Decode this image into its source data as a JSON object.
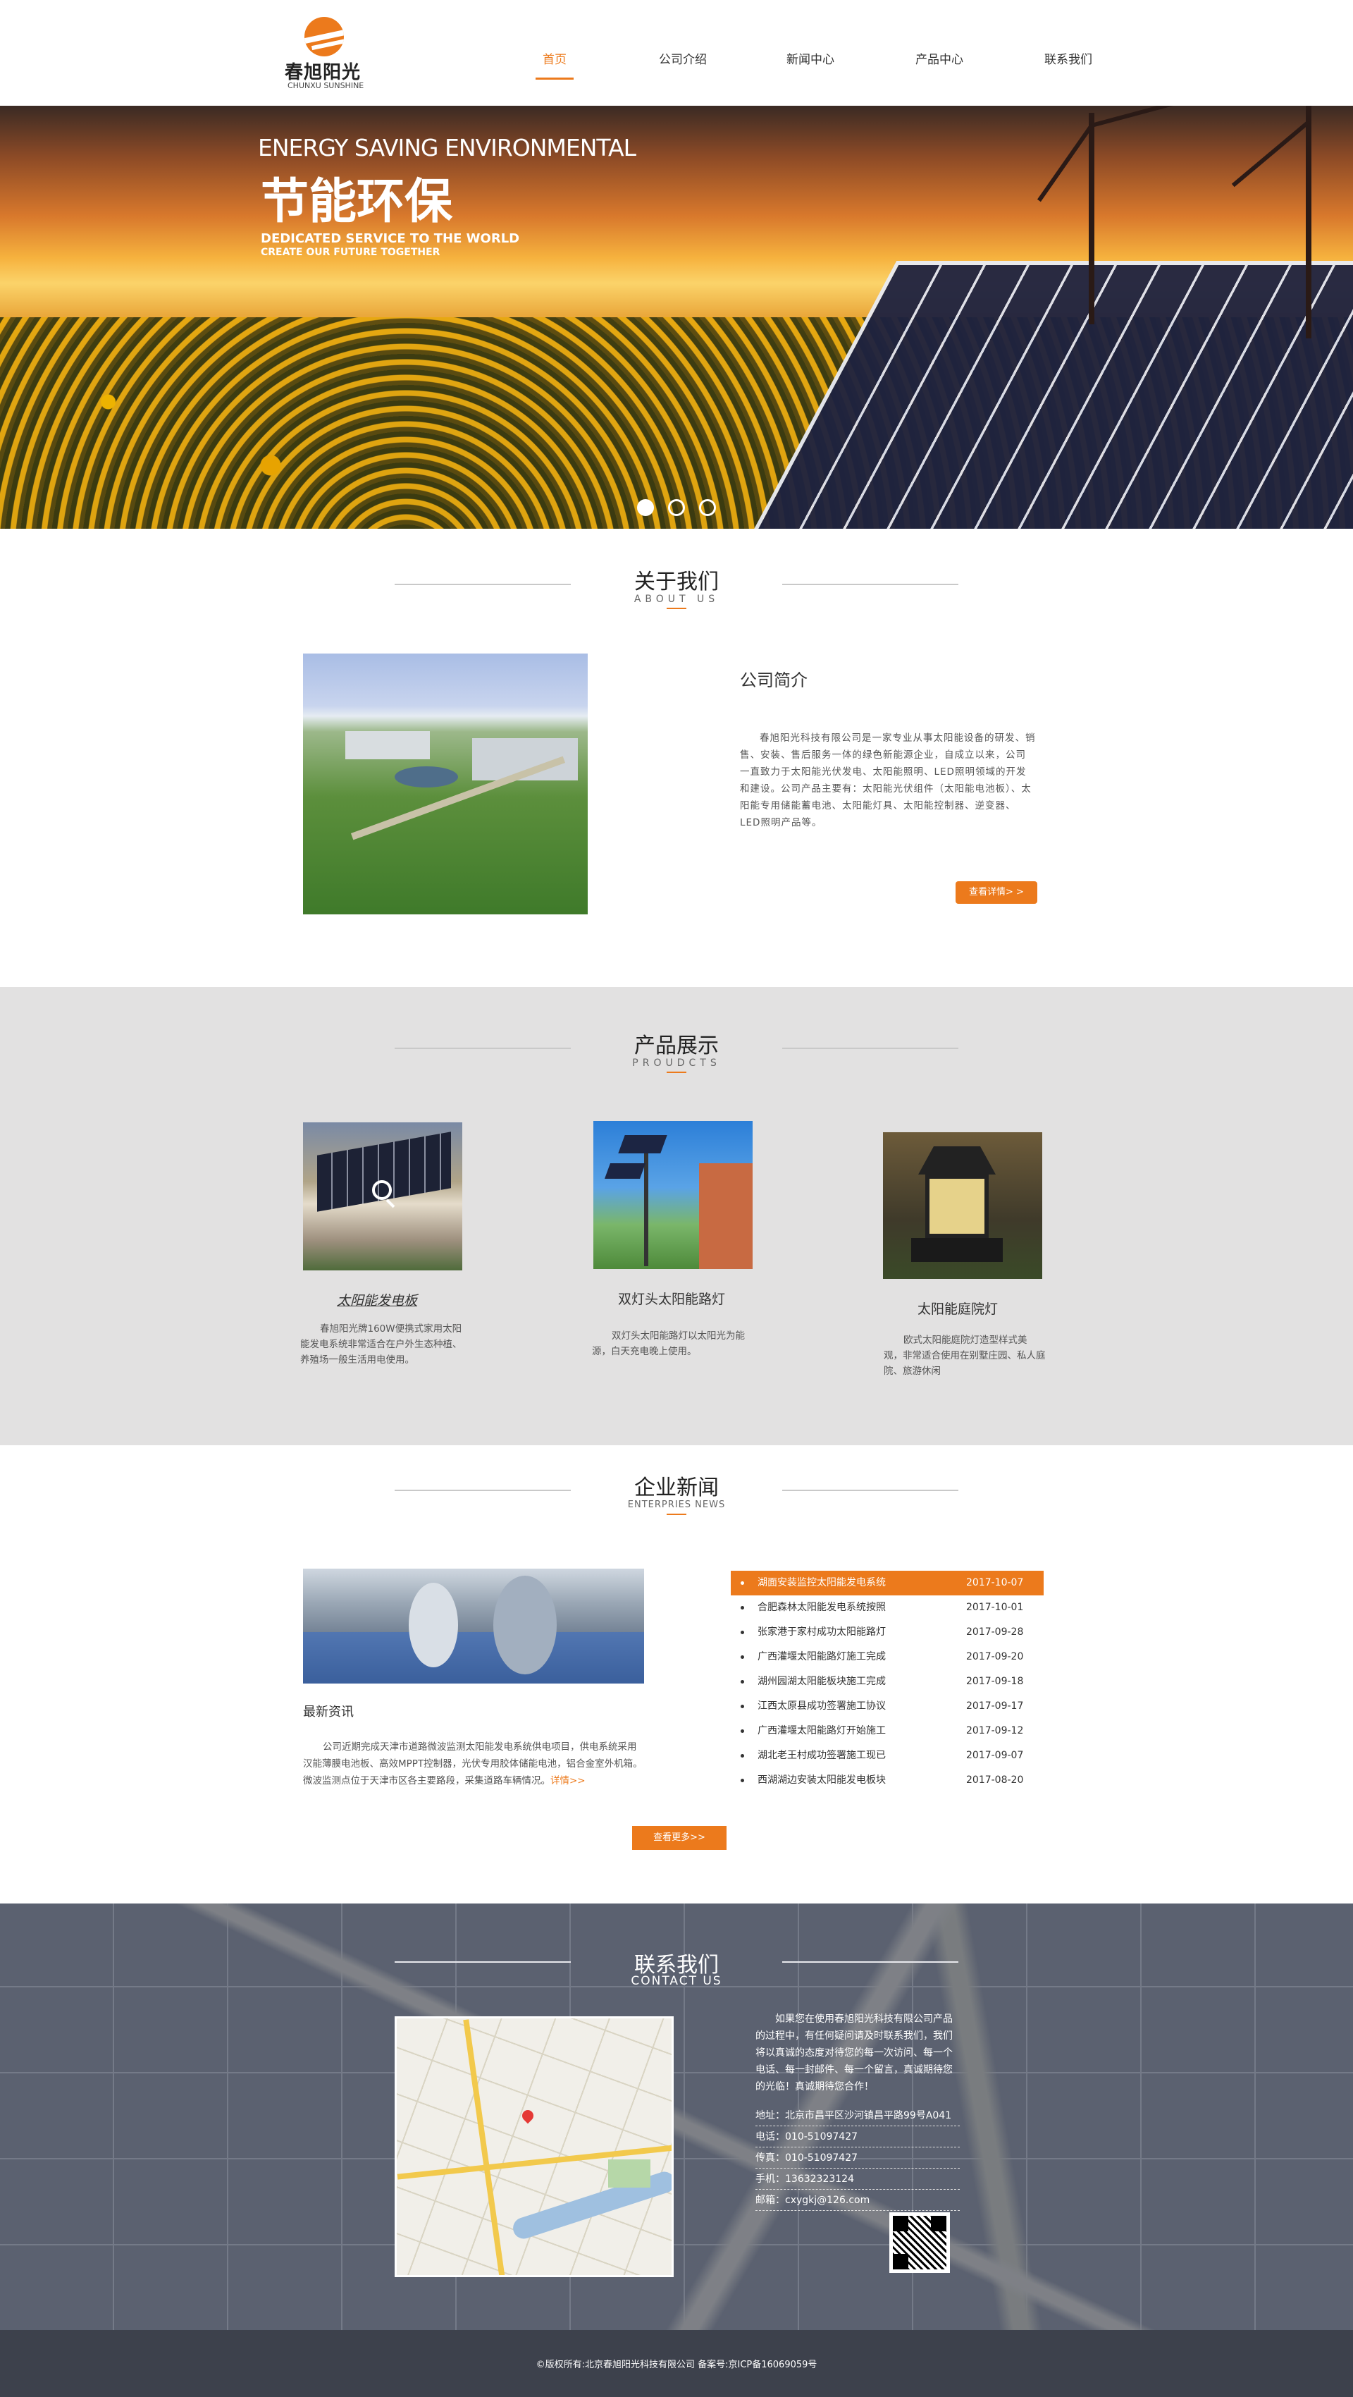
{
  "logo": {
    "cn": "春旭阳光",
    "en": "CHUNXU SUNSHINE"
  },
  "nav": [
    {
      "label": "首页",
      "active": true
    },
    {
      "label": "公司介绍",
      "active": false
    },
    {
      "label": "新闻中心",
      "active": false
    },
    {
      "label": "产品中心",
      "active": false
    },
    {
      "label": "联系我们",
      "active": false
    }
  ],
  "banner": {
    "line1": "ENERGY SAVING ENVIRONMENTAL",
    "line2": "节能环保",
    "line3": "DEDICATED SERVICE TO THE WORLD",
    "line4": "CREATE OUR FUTURE TOGETHER",
    "active_slide": 1,
    "slide_count": 3
  },
  "about": {
    "title_cn": "关于我们",
    "title_en": "ABOUT US",
    "heading": "公司简介",
    "body": "春旭阳光科技有限公司是一家专业从事太阳能设备的研发、销售、安装、售后服务一体的绿色新能源企业，自成立以来，公司一直致力于太阳能光伏发电、太阳能照明、LED照明领域的开发和建设。公司产品主要有：太阳能光伏组件（太阳能电池板）、太阳能专用储能蓄电池、太阳能灯具、太阳能控制器、逆变器、LED照明产品等。",
    "more": "查看详情> >"
  },
  "products": {
    "title_cn": "产品展示",
    "title_en": "PROUDCTS",
    "items": [
      {
        "title": "太阳能发电板",
        "desc": "春旭阳光牌160W便携式家用太阳能发电系统非常适合在户外生态种植、养殖场一般生活用电使用。"
      },
      {
        "title": "双灯头太阳能路灯",
        "desc": "双灯头太阳能路灯以太阳光为能源，白天充电晚上使用。"
      },
      {
        "title": "太阳能庭院灯",
        "desc": "欧式太阳能庭院灯造型样式美观，非常适合使用在别墅庄园、私人庭院、旅游休闲"
      }
    ]
  },
  "news": {
    "title_cn": "企业新闻",
    "title_en": "ENTERPRIES NEWS",
    "feature_title": "最新资讯",
    "feature_body": "公司近期完成天津市道路微波监测太阳能发电系统供电项目，供电系统采用汉能薄膜电池板、高效MPPT控制器，光伏专用胶体储能电池，铝合金室外机箱。微波监测点位于天津市区各主要路段，采集道路车辆情况。",
    "feature_more": "详情>>",
    "items": [
      {
        "title": "湖面安装监控太阳能发电系统",
        "date": "2017-10-07"
      },
      {
        "title": "合肥森林太阳能发电系统按照",
        "date": "2017-10-01"
      },
      {
        "title": "张家港于家村成功太阳能路灯",
        "date": "2017-09-28"
      },
      {
        "title": "广西灌堰太阳能路灯施工完成",
        "date": "2017-09-20"
      },
      {
        "title": "湖州园湖太阳能板块施工完成",
        "date": "2017-09-18"
      },
      {
        "title": "江西太原县成功签署施工协议",
        "date": "2017-09-17"
      },
      {
        "title": "广西灌堰太阳能路灯开始施工",
        "date": "2017-09-12"
      },
      {
        "title": "湖北老王村成功签署施工现已",
        "date": "2017-09-07"
      },
      {
        "title": "西湖湖边安装太阳能发电板块",
        "date": "2017-08-20"
      }
    ],
    "more": "查看更多>>"
  },
  "contact": {
    "title_cn": "联系我们",
    "title_en": "CONTACT US",
    "intro": "如果您在使用春旭阳光科技有限公司产品的过程中，有任何疑问请及时联系我们，我们将以真诚的态度对待您的每一次访问、每一个电话、每一封邮件、每一个留言，真诚期待您的光临！真诚期待您合作！",
    "address": "地址：北京市昌平区沙河镇昌平路99号A041",
    "phone": "电话：010-51097427",
    "fax": "传真：010-51097427",
    "mobile": "手机：13632323124",
    "email": "邮箱：cxygkj@126.com"
  },
  "footer": {
    "text": "©版权所有:北京春旭阳光科技有限公司    备案号:京ICP备16069059号"
  },
  "colors": {
    "accent": "#ec7a1c",
    "product_bg": "#e2e1e1",
    "footer_bg": "#3d414c"
  }
}
